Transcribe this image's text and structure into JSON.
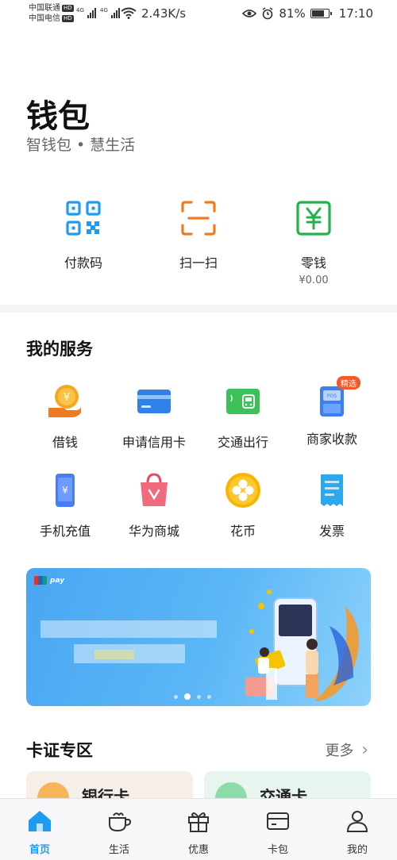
{
  "status_bar": {
    "carrier_1": "中国联通",
    "carrier_2": "中国电信",
    "hd": "HD",
    "net_type": "4G",
    "net_speed": "2.43K/s",
    "battery": "81%",
    "battery_level": 0.81,
    "time": "17:10"
  },
  "header": {
    "title": "钱包",
    "subtitle": "智钱包 • 慧生活"
  },
  "quick_actions": [
    {
      "label": "付款码",
      "icon": "qr-code-icon"
    },
    {
      "label": "扫一扫",
      "icon": "scan-icon"
    },
    {
      "label": "零钱",
      "icon": "yuan-icon",
      "sub": "¥0.00"
    }
  ],
  "services": {
    "title": "我的服务",
    "items": [
      {
        "label": "借钱",
        "icon": "coin-hand-icon"
      },
      {
        "label": "申请信用卡",
        "icon": "credit-card-icon"
      },
      {
        "label": "交通出行",
        "icon": "transit-card-icon"
      },
      {
        "label": "商家收款",
        "icon": "pos-icon",
        "tag": "精选"
      },
      {
        "label": "手机充值",
        "icon": "phone-topup-icon"
      },
      {
        "label": "华为商城",
        "icon": "shopping-bag-icon"
      },
      {
        "label": "花币",
        "icon": "huabi-coin-icon"
      },
      {
        "label": "发票",
        "icon": "invoice-icon"
      }
    ]
  },
  "banner": {
    "brand": "pay"
  },
  "cards_section": {
    "title": "卡证专区",
    "more": "更多",
    "cards": [
      {
        "label": "银行卡"
      },
      {
        "label": "交通卡"
      }
    ]
  },
  "tabbar": [
    {
      "label": "首页",
      "icon": "home-icon",
      "active": true
    },
    {
      "label": "生活",
      "icon": "coffee-cup-icon"
    },
    {
      "label": "优惠",
      "icon": "gift-icon"
    },
    {
      "label": "卡包",
      "icon": "card-wallet-icon"
    },
    {
      "label": "我的",
      "icon": "person-icon"
    }
  ],
  "colors": {
    "accent": "#1e9bf0",
    "orange": "#f07a22",
    "green": "#22b14c"
  }
}
